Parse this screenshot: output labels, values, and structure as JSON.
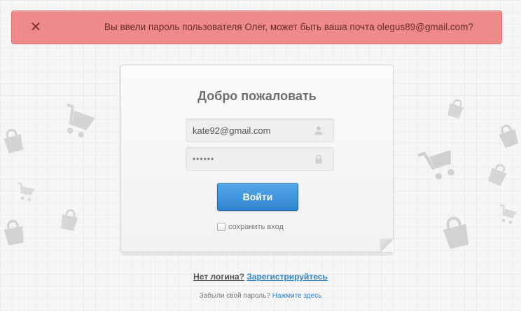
{
  "alert": {
    "close_glyph": "✕",
    "message": "Вы ввели пароль пользователя Олег, может быть ваша почта olegus89@gmail.com?",
    "color": "#ef8a8a"
  },
  "login": {
    "title": "Добро пожаловать",
    "email_value": "kate92@gmail.com",
    "password_value": "••••••",
    "email_icon": "user-icon",
    "password_icon": "lock-icon",
    "submit_label": "Войти",
    "remember_label": "сохранить вход",
    "remember_checked": false,
    "button_color": "#3b8fd8"
  },
  "footer": {
    "signup_question": "Нет логина?",
    "signup_link": "Зарегистрируйтесь",
    "forgot_question": "Забыли свой пароль?",
    "forgot_link": "Нажмите здесь",
    "link_color": "#2f83c9"
  },
  "background": {
    "decorative_icons": [
      "shopping-cart-icon",
      "shopping-bag-icon"
    ]
  }
}
